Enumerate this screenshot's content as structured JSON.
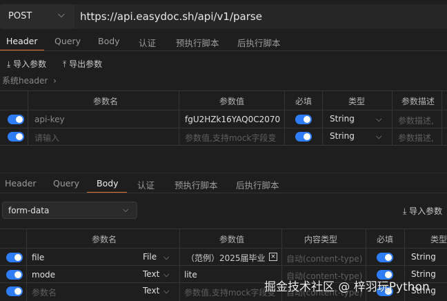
{
  "request": {
    "method": "POST",
    "url": "https://api.easydoc.sh/api/v1/parse"
  },
  "top_tabs": [
    "Header",
    "Query",
    "Body",
    "认证",
    "预执行脚本",
    "后执行脚本"
  ],
  "header_toolbar": {
    "import": "导入参数",
    "export": "导出参数",
    "system_header": "系统header"
  },
  "header_table": {
    "columns": [
      "参数名",
      "参数值",
      "必填",
      "类型",
      "参数描述"
    ],
    "rows": [
      {
        "name": "api-key",
        "value": "fgU2HZk16YAQ0C2070",
        "type": "String",
        "desc": "参数描述,"
      },
      {
        "name": "请输入",
        "value": "参数值,支持mock字段变",
        "type": "String",
        "desc": "参数描述,"
      }
    ]
  },
  "bottom_tabs": [
    "Header",
    "Query",
    "Body",
    "认证",
    "预执行脚本",
    "后执行脚本"
  ],
  "body": {
    "mode": "form-data",
    "import": "导入参数",
    "columns": [
      "参数名",
      "参数值",
      "内容类型",
      "必填",
      "类型"
    ],
    "rows": [
      {
        "name": "file",
        "kind": "File",
        "value": "（范例）2025届毕业",
        "content_type": "自动(content-type)",
        "type": "String"
      },
      {
        "name": "mode",
        "kind": "Text",
        "value": "lite",
        "content_type": "自动(content-type)",
        "type": "String"
      },
      {
        "name": "参数名",
        "kind": "Text",
        "value": "参数值,支持mock字段变",
        "content_type": "自动(content-type)",
        "type": "String"
      }
    ]
  },
  "watermark": "掘金技术社区 @ 梓羽玩Python",
  "colors": {
    "accent": "#e2703a",
    "toggle": "#2f7df6",
    "background": "#1e1e1e"
  }
}
